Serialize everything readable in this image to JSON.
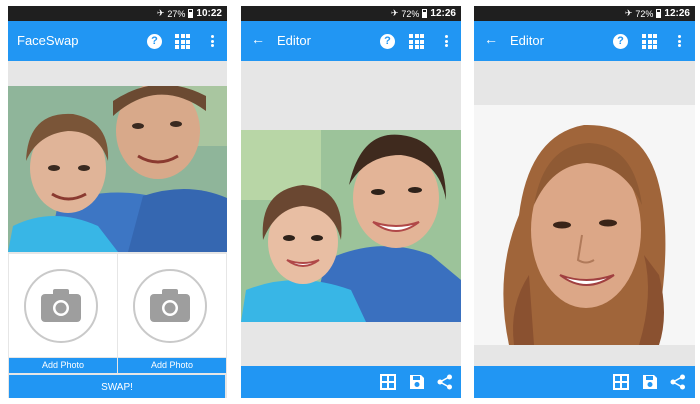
{
  "screens": [
    {
      "status": {
        "battery": "27%",
        "time": "10:22"
      },
      "title": "FaceSwap",
      "add_photo_labels": [
        "Add Photo",
        "Add Photo"
      ],
      "swap_label": "SWAP!"
    },
    {
      "status": {
        "battery": "72%",
        "time": "12:26"
      },
      "title": "Editor"
    },
    {
      "status": {
        "battery": "72%",
        "time": "12:26"
      },
      "title": "Editor"
    }
  ],
  "icons": {
    "help": "?",
    "back": "←",
    "airplane": "✈",
    "status_bar_icons": [
      "airplane-mode-icon",
      "battery-icon"
    ],
    "app_bar_icons": [
      "back-arrow-icon",
      "help-icon",
      "grid-icon",
      "overflow-menu-icon"
    ],
    "bottom_bar_icons": [
      "grid-view-icon",
      "save-icon",
      "share-icon"
    ],
    "slot_icon": "camera-icon"
  },
  "colors": {
    "accent": "#2196f3",
    "status_bar": "#1f1f1f",
    "background": "#e6e6e6",
    "camera_circle": "#c9c9c9"
  }
}
